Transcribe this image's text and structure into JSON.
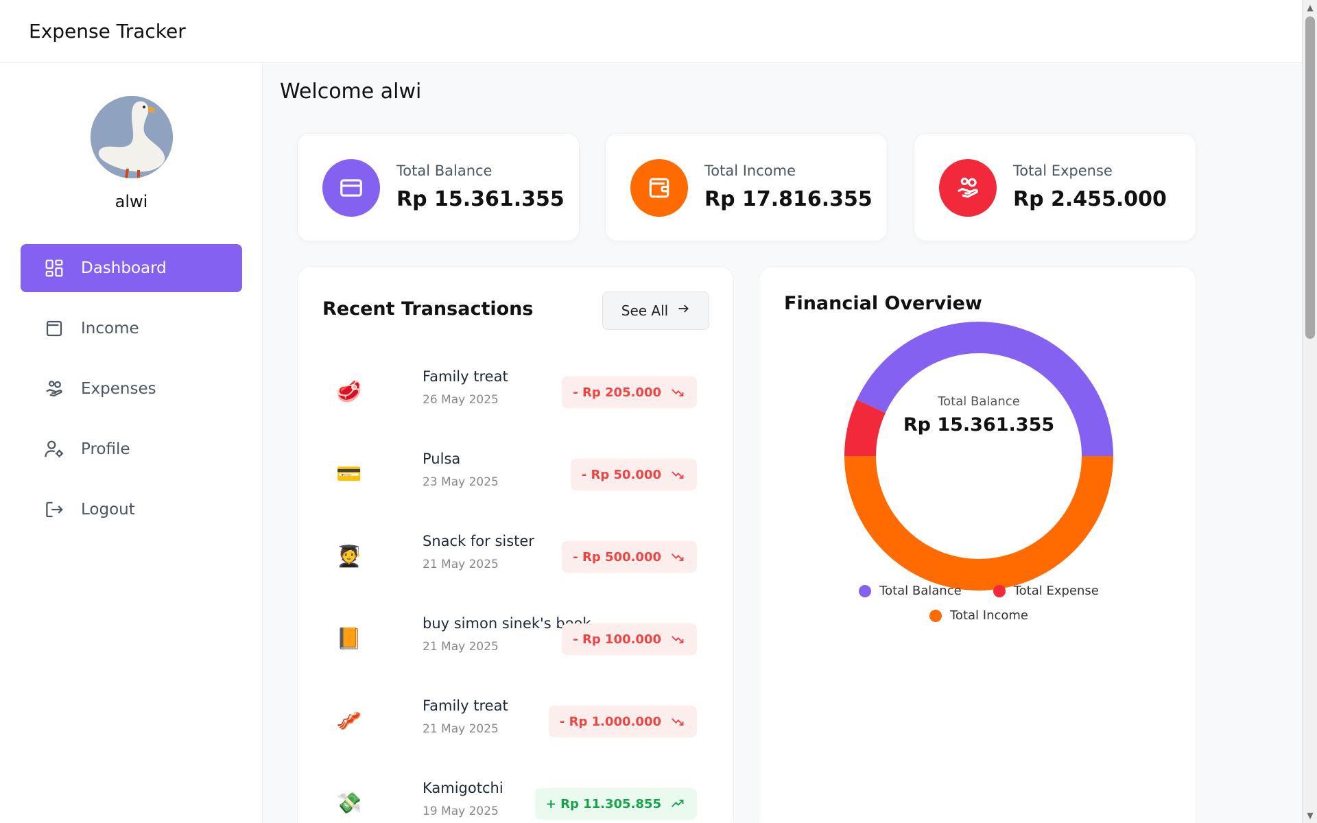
{
  "app": {
    "title": "Expense Tracker"
  },
  "user": {
    "name": "alwi"
  },
  "sidebar": {
    "items": [
      {
        "label": "Dashboard",
        "icon": "dashboard-icon",
        "active": true
      },
      {
        "label": "Income",
        "icon": "wallet-icon",
        "active": false
      },
      {
        "label": "Expenses",
        "icon": "hand-coins-icon",
        "active": false
      },
      {
        "label": "Profile",
        "icon": "user-cog-icon",
        "active": false
      },
      {
        "label": "Logout",
        "icon": "logout-icon",
        "active": false
      }
    ]
  },
  "main": {
    "welcome": "Welcome alwi",
    "stats": [
      {
        "label": "Total Balance",
        "value": "Rp 15.361.355",
        "color": "#8561f2",
        "icon": "credit-card-icon"
      },
      {
        "label": "Total Income",
        "value": "Rp 17.816.355",
        "color": "#ff6b00",
        "icon": "wallet-icon"
      },
      {
        "label": "Total Expense",
        "value": "Rp 2.455.000",
        "color": "#f1293a",
        "icon": "hand-coins-icon"
      }
    ]
  },
  "transactions": {
    "title": "Recent Transactions",
    "see_all": "See All",
    "items": [
      {
        "name": "Family treat",
        "date": "26 May 2025",
        "amount": "- Rp 205.000",
        "type": "expense",
        "icon": "meat-emoji",
        "glyph": "🥩"
      },
      {
        "name": "Pulsa",
        "date": "23 May 2025",
        "amount": "- Rp 50.000",
        "type": "expense",
        "icon": "credit-card-emoji",
        "glyph": "💳"
      },
      {
        "name": "Snack for sister",
        "date": "21 May 2025",
        "amount": "- Rp 500.000",
        "type": "expense",
        "icon": "student-emoji",
        "glyph": "🧑‍🎓"
      },
      {
        "name": "buy simon sinek's book",
        "date": "21 May 2025",
        "amount": "- Rp 100.000",
        "type": "expense",
        "icon": "book-emoji",
        "glyph": "📙"
      },
      {
        "name": "Family treat",
        "date": "21 May 2025",
        "amount": "- Rp 1.000.000",
        "type": "expense",
        "icon": "bacon-emoji",
        "glyph": "🥓"
      },
      {
        "name": "Kamigotchi",
        "date": "19 May 2025",
        "amount": "+ Rp 11.305.855",
        "type": "income",
        "icon": "money-emoji",
        "glyph": "💸"
      }
    ]
  },
  "overview": {
    "title": "Financial Overview",
    "center_label": "Total Balance",
    "center_value": "Rp 15.361.355",
    "legend": [
      {
        "label": "Total Balance",
        "color": "#8561f2"
      },
      {
        "label": "Total Expense",
        "color": "#f1293a"
      },
      {
        "label": "Total Income",
        "color": "#ff6b00"
      }
    ]
  },
  "chart_data": {
    "type": "pie",
    "title": "Financial Overview",
    "categories": [
      "Total Balance",
      "Total Expense",
      "Total Income"
    ],
    "values": [
      15361355,
      2455000,
      17816355
    ],
    "colors": [
      "#8561f2",
      "#f1293a",
      "#ff6b00"
    ],
    "legend": "bottom"
  }
}
